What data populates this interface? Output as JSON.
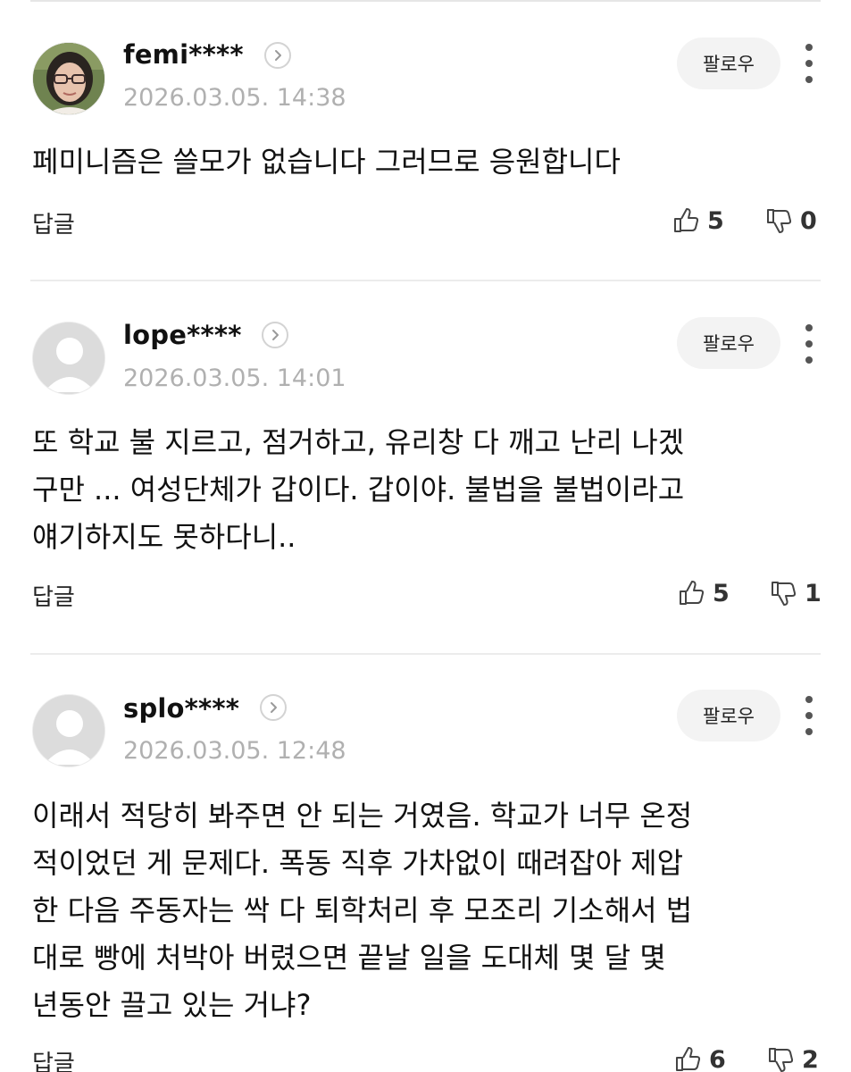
{
  "comments": [
    {
      "username": "femi****",
      "timestamp": "2026.03.05. 14:38",
      "follow_label": "팔로우",
      "avatar": "profile-photo",
      "body_lines": [
        "페미니즘은 쓸모가 없습니다 그러므로 응원합니다"
      ],
      "reply_label": "답글",
      "likes": "5",
      "dislikes": "0"
    },
    {
      "username": "lope****",
      "timestamp": "2026.03.05. 14:01",
      "follow_label": "팔로우",
      "avatar": "default-avatar",
      "body_lines": [
        "또 학교 불 지르고, 점거하고, 유리창 다 깨고 난리 나겠",
        "구만 ... 여성단체가 갑이다. 갑이야. 불법을 불법이라고",
        "얘기하지도 못하다니.."
      ],
      "reply_label": "답글",
      "likes": "5",
      "dislikes": "1"
    },
    {
      "username": "splo****",
      "timestamp": "2026.03.05. 12:48",
      "follow_label": "팔로우",
      "avatar": "default-avatar",
      "body_lines": [
        "이래서 적당히 봐주면 안 되는 거였음. 학교가 너무 온정",
        "적이었던 게 문제다. 폭동 직후 가차없이 때려잡아 제압",
        "한 다음 주동자는 싹 다 퇴학처리 후 모조리 기소해서 법",
        "대로 빵에 처박아 버렸으면 끝날 일을 도대체 몇 달 몇",
        "년동안 끌고 있는 거냐?"
      ],
      "reply_label": "답글",
      "likes": "6",
      "dislikes": "2"
    }
  ],
  "icons": {
    "chevron": "chevron-right-icon",
    "like": "thumbs-up-icon",
    "dislike": "thumbs-down-icon",
    "more": "more-vertical-icon"
  },
  "colors": {
    "text": "#111111",
    "muted": "#b0b0b0",
    "follow_bg": "#f3f3f3",
    "divider": "#ececec"
  }
}
